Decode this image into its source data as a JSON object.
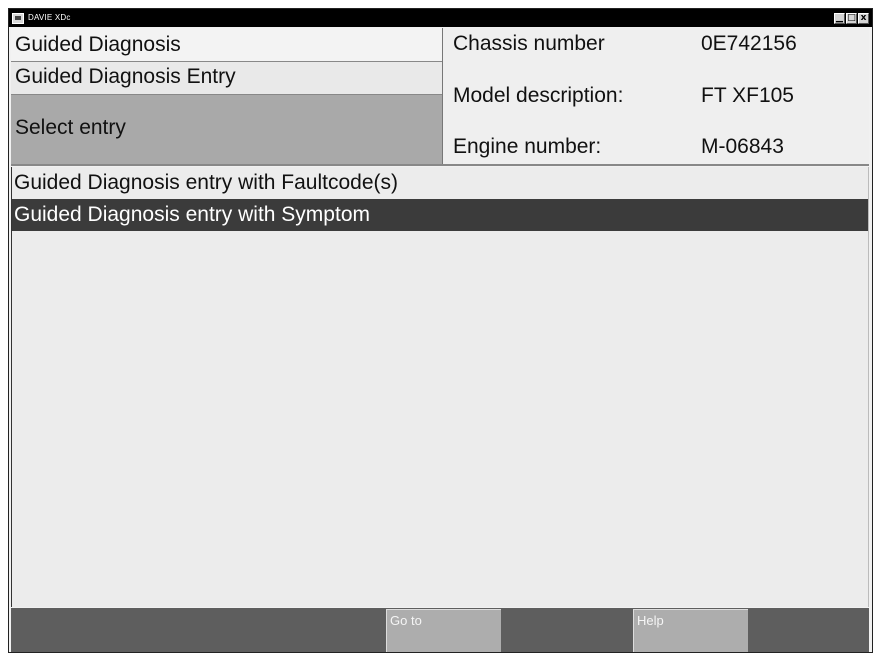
{
  "window": {
    "title": "DAVIE XDc",
    "controls": {
      "minimize": "▁",
      "maximize": "□",
      "close": "x"
    }
  },
  "header": {
    "breadcrumb_title": "Guided Diagnosis",
    "breadcrumb_sub": "Guided Diagnosis Entry",
    "instruction": "Select entry"
  },
  "vehicle": {
    "chassis_label": "Chassis number",
    "chassis_value": "0E742156",
    "model_label": "Model description:",
    "model_value": "FT XF105",
    "engine_label": "Engine number:",
    "engine_value": "M-06843"
  },
  "entries": [
    {
      "label": "Guided Diagnosis entry with Faultcode(s)",
      "selected": false
    },
    {
      "label": "Guided Diagnosis entry with Symptom",
      "selected": true
    }
  ],
  "buttons": {
    "goto": "Go to",
    "help": "Help"
  },
  "colors": {
    "titlebar": "#000000",
    "selected_row": "#3b3b3b",
    "select_entry_bg": "#a9a9a9",
    "button_bar": "#5e5e5e",
    "button": "#adadad"
  }
}
